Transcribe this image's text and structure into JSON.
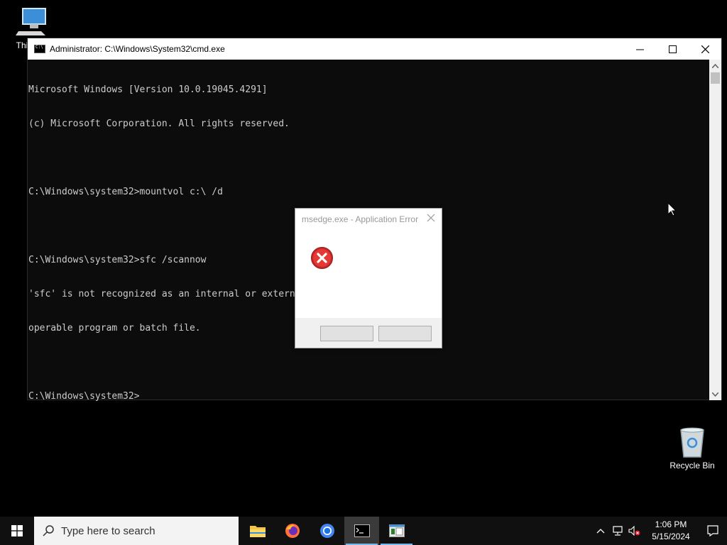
{
  "desktop": {
    "icons": [
      {
        "label": "This PC",
        "icon": "computer-icon"
      },
      {
        "label": "Recycle Bin",
        "icon": "recycle-bin-icon"
      }
    ]
  },
  "cmd_window": {
    "title": "Administrator: C:\\Windows\\System32\\cmd.exe",
    "lines": [
      "Microsoft Windows [Version 10.0.19045.4291]",
      "(c) Microsoft Corporation. All rights reserved.",
      "",
      "C:\\Windows\\system32>mountvol c:\\ /d",
      "",
      "C:\\Windows\\system32>sfc /scannow",
      "'sfc' is not recognized as an internal or external command,",
      "operable program or batch file.",
      "",
      "C:\\Windows\\system32>"
    ],
    "colors": {
      "background": "#0c0c0c",
      "text": "#cccccc"
    }
  },
  "error_dialog": {
    "title": "msedge.exe - Application Error",
    "icon": "error-icon",
    "buttons": [
      "",
      ""
    ]
  },
  "taskbar": {
    "search_placeholder": "Type here to search",
    "apps": [
      {
        "name": "File Explorer",
        "icon": "folder-icon"
      },
      {
        "name": "Firefox",
        "icon": "firefox-icon"
      },
      {
        "name": "Chrome",
        "icon": "chrome-icon"
      },
      {
        "name": "Command Prompt",
        "icon": "cmd-icon",
        "active": true
      },
      {
        "name": "Application",
        "icon": "app-window-icon"
      }
    ],
    "clock": {
      "time": "1:06 PM",
      "date": "5/15/2024"
    },
    "accent": "#76b9ed"
  }
}
